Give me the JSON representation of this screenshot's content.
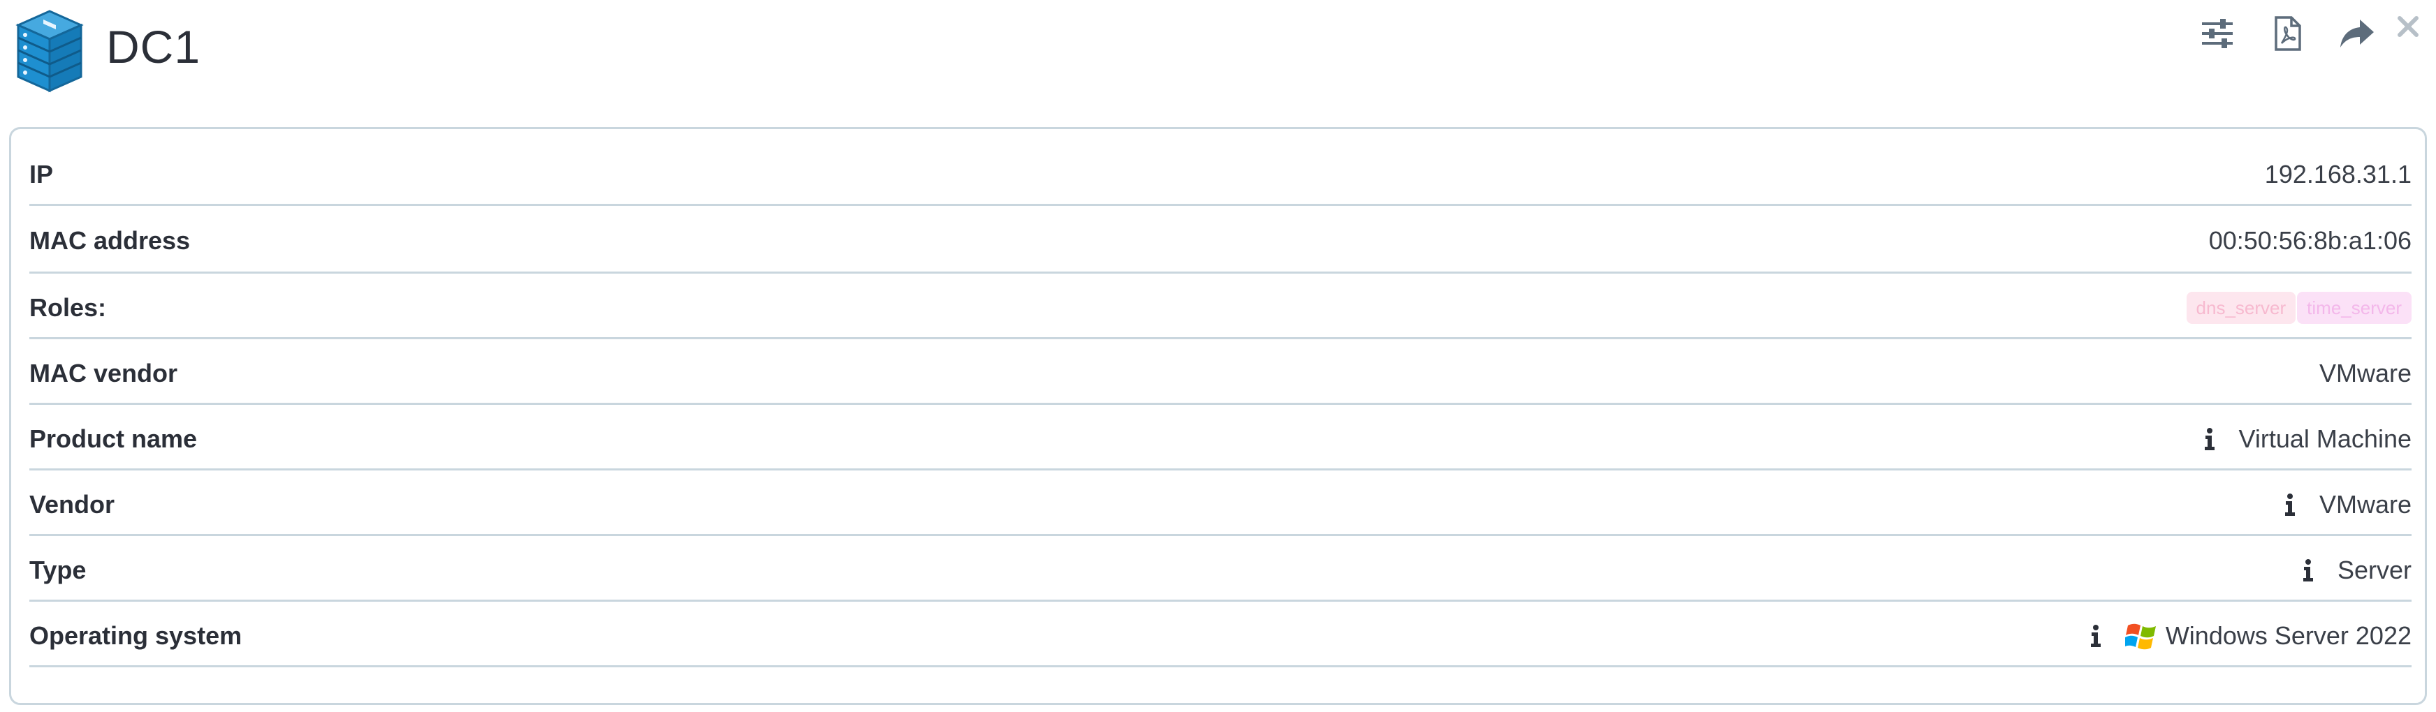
{
  "header": {
    "device_name": "DC1",
    "device_icon": "server-stack-icon",
    "toolbar": {
      "settings_icon": "sliders-icon",
      "pdf_icon": "pdf-file-icon",
      "share_icon": "share-arrow-icon",
      "close_icon": "close-icon"
    }
  },
  "details": {
    "ip": {
      "label": "IP",
      "value": "192.168.31.1"
    },
    "mac_address": {
      "label": "MAC address",
      "value": "00:50:56:8b:a1:06"
    },
    "roles": {
      "label": "Roles:",
      "items": [
        "dns_server",
        "time_server"
      ]
    },
    "mac_vendor": {
      "label": "MAC vendor",
      "value": "VMware"
    },
    "product_name": {
      "label": "Product name",
      "value": "Virtual Machine"
    },
    "vendor": {
      "label": "Vendor",
      "value": "VMware"
    },
    "type": {
      "label": "Type",
      "value": "Server"
    },
    "operating_system": {
      "label": "Operating system",
      "value": "Windows Server 2022",
      "icon": "windows-logo-icon"
    }
  },
  "colors": {
    "accent_blue": "#1e8fd0",
    "border": "#c9d6de",
    "toolbar_icon": "#5d6c7b",
    "badge_dns_bg": "#fde6ee",
    "badge_time_bg": "#fbe1f7"
  }
}
